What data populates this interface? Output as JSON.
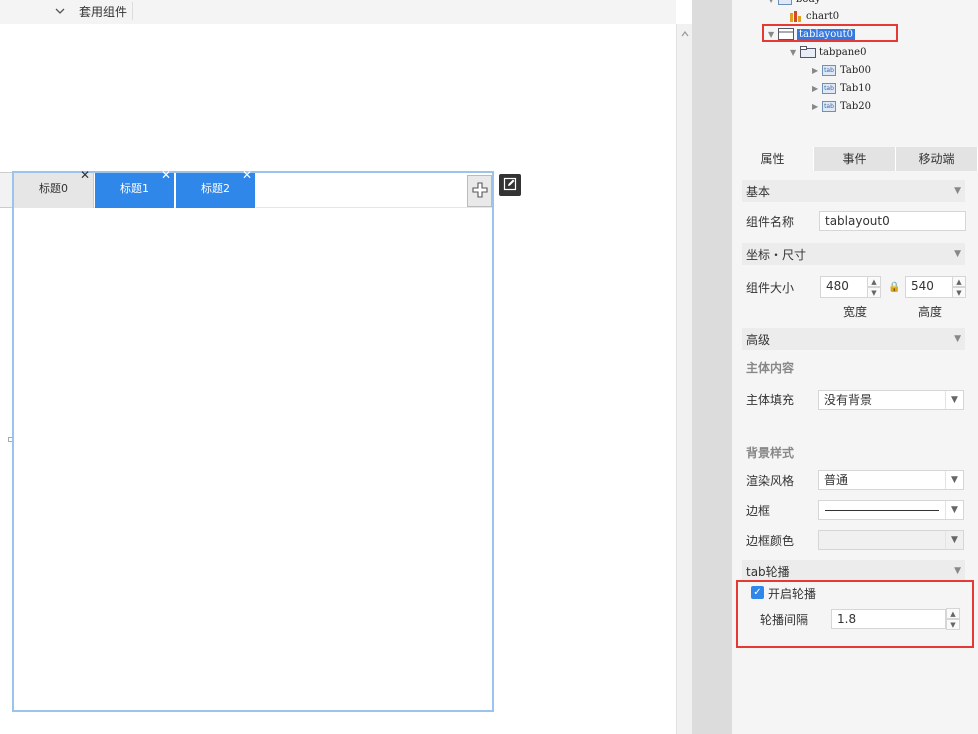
{
  "topbar": {
    "label": "套用组件"
  },
  "canvas": {
    "tabs": [
      {
        "label": "标题0",
        "state": "inactive"
      },
      {
        "label": "标题1",
        "state": "active"
      },
      {
        "label": "标题2",
        "state": "active"
      }
    ],
    "tab_close_glyph": "✕",
    "add_tab_icon": "plus-icon",
    "edit_icon": "edit-icon"
  },
  "tree": {
    "partial_top": "body",
    "items": [
      {
        "label": "chart0",
        "icon": "chart-icon"
      },
      {
        "label": "tablayout0",
        "icon": "layout-icon",
        "selected": true
      },
      {
        "label": "tabpane0",
        "icon": "tabpane-icon"
      },
      {
        "label": "Tab00",
        "icon": "tab-icon"
      },
      {
        "label": "Tab10",
        "icon": "tab-icon"
      },
      {
        "label": "Tab20",
        "icon": "tab-icon"
      }
    ],
    "tab_icon_text": "tab"
  },
  "panel_tabs": [
    "属性",
    "事件",
    "移动端"
  ],
  "props": {
    "basic_header": "基本",
    "name_label": "组件名称",
    "name_value": "tablayout0",
    "coord_header": "坐标・尺寸",
    "size_label": "组件大小",
    "width_value": "480",
    "height_value": "540",
    "width_label": "宽度",
    "height_label": "高度",
    "advanced_header": "高级",
    "body_content_label": "主体内容",
    "body_fill_label": "主体填充",
    "body_fill_value": "没有背景",
    "bg_style_label": "背景样式",
    "render_style_label": "渲染风格",
    "render_style_value": "普通",
    "border_label": "边框",
    "border_color_label": "边框颜色",
    "carousel_header": "tab轮播",
    "carousel_enable_label": "开启轮播",
    "carousel_enabled": true,
    "carousel_interval_label": "轮播间隔",
    "carousel_interval_value": "1.8"
  },
  "colors": {
    "accent": "#2f87ea",
    "highlight_box": "#e53935",
    "selection": "#3579e0"
  }
}
